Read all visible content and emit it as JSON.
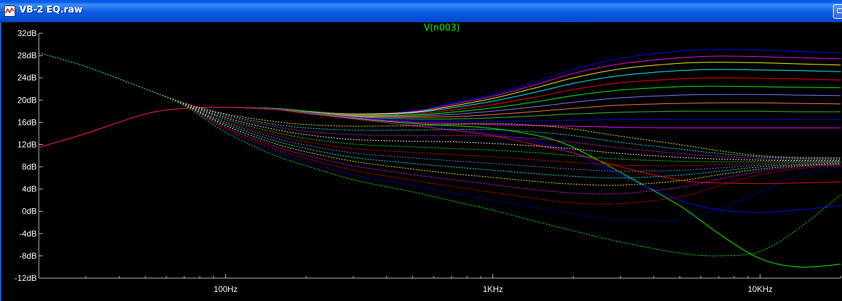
{
  "window": {
    "title": "VB-2 EQ.raw"
  },
  "colors": {
    "background": "#000000",
    "axis": "#c0c0c0",
    "grid": "#808080",
    "trace_title": "#00ff00"
  },
  "chart_data": {
    "type": "line",
    "title": "V(n003)",
    "x_scale": "log",
    "xlim": [
      20,
      20000
    ],
    "ylim": [
      -12,
      32
    ],
    "grid": false,
    "x_ticks": [
      {
        "value": 100,
        "label": "100Hz"
      },
      {
        "value": 1000,
        "label": "1KHz"
      },
      {
        "value": 10000,
        "label": "10KHz"
      }
    ],
    "y_ticks": [
      {
        "value": 32,
        "label": "32dB"
      },
      {
        "value": 28,
        "label": "28dB"
      },
      {
        "value": 24,
        "label": "24dB"
      },
      {
        "value": 20,
        "label": "20dB"
      },
      {
        "value": 16,
        "label": "16dB"
      },
      {
        "value": 12,
        "label": "12dB"
      },
      {
        "value": 8,
        "label": "8dB"
      },
      {
        "value": 4,
        "label": "4dB"
      },
      {
        "value": 0,
        "label": "0dB"
      },
      {
        "value": -4,
        "label": "-4dB"
      },
      {
        "value": -8,
        "label": "-8dB"
      },
      {
        "value": -12,
        "label": "-12dB"
      }
    ],
    "x": [
      20,
      30,
      50,
      70,
      100,
      150,
      200,
      300,
      500,
      700,
      1000,
      1500,
      2000,
      3000,
      5000,
      7000,
      10000,
      14000,
      20000
    ],
    "series": [
      {
        "color": "#0000ff",
        "style": "solid",
        "values": [
          11.5,
          14,
          17.5,
          18.5,
          18.7,
          18.5,
          18,
          17.5,
          18,
          19.5,
          21,
          23.5,
          25.5,
          27.5,
          28.8,
          29.1,
          29,
          28.7,
          28.5
        ]
      },
      {
        "color": "#ff00ff",
        "style": "solid",
        "values": [
          11.5,
          14,
          17.5,
          18.5,
          18.7,
          18.5,
          18,
          17.5,
          17.9,
          19.2,
          20.7,
          23,
          24.8,
          26.5,
          27.6,
          27.9,
          27.8,
          27.6,
          27.4
        ]
      },
      {
        "color": "#ffff00",
        "style": "solid",
        "values": [
          11.5,
          14,
          17.5,
          18.5,
          18.7,
          18.5,
          18,
          17.5,
          17.8,
          18.9,
          20.3,
          22.4,
          24,
          25.6,
          26.6,
          26.8,
          26.7,
          26.5,
          26.3
        ]
      },
      {
        "color": "#00ffff",
        "style": "solid",
        "values": [
          11.5,
          14,
          17.5,
          18.5,
          18.7,
          18.5,
          18,
          17.4,
          17.7,
          18.6,
          19.8,
          21.6,
          23,
          24.4,
          25.3,
          25.5,
          25.4,
          25.3,
          25.1
        ]
      },
      {
        "color": "#ff0000",
        "style": "solid",
        "values": [
          11.5,
          14,
          17.5,
          18.5,
          18.7,
          18.5,
          18,
          17.4,
          17.5,
          18.2,
          19.2,
          20.7,
          21.9,
          23.1,
          23.8,
          24,
          23.9,
          23.8,
          23.6
        ]
      },
      {
        "color": "#00ff00",
        "style": "solid",
        "values": [
          11.5,
          14,
          17.5,
          18.5,
          18.7,
          18.5,
          18,
          17.3,
          17.3,
          17.8,
          18.6,
          19.8,
          20.8,
          21.8,
          22.4,
          22.5,
          22.4,
          22.3,
          22.2
        ]
      },
      {
        "color": "#8080ff",
        "style": "solid",
        "values": [
          11.5,
          14,
          17.5,
          18.5,
          18.7,
          18.4,
          17.9,
          17.2,
          17.1,
          17.4,
          18,
          18.9,
          19.6,
          20.4,
          20.9,
          21,
          21,
          20.9,
          20.8
        ]
      },
      {
        "color": "#ff8040",
        "style": "solid",
        "values": [
          11.5,
          14,
          17.5,
          18.5,
          18.7,
          18.4,
          17.9,
          17.1,
          16.9,
          17,
          17.4,
          18,
          18.5,
          19.1,
          19.4,
          19.5,
          19.5,
          19.4,
          19.3
        ]
      },
      {
        "color": "#40c040",
        "style": "solid",
        "values": [
          11.5,
          14,
          17.5,
          18.5,
          18.7,
          18.4,
          17.8,
          17,
          16.6,
          16.6,
          16.8,
          17.2,
          17.5,
          17.8,
          18,
          18,
          18,
          17.9,
          17.9
        ]
      },
      {
        "color": "#0000ff",
        "style": "solid",
        "values": [
          11.5,
          14,
          17.5,
          18.5,
          18.7,
          18.4,
          17.8,
          16.9,
          16.3,
          16.2,
          16.2,
          16.3,
          16.4,
          16.5,
          16.5,
          16.5,
          16.5,
          16.5,
          16.5
        ]
      },
      {
        "color": "#ff00ff",
        "style": "solid",
        "values": [
          11.5,
          14,
          17.5,
          18.5,
          18.7,
          18.3,
          17.7,
          16.8,
          16,
          15.8,
          15.6,
          15.4,
          15.3,
          15.1,
          15,
          15,
          15,
          15,
          15
        ]
      },
      {
        "color": "#00ff00",
        "style": "solid",
        "values": [
          11.5,
          14,
          17.5,
          18.5,
          18.7,
          18.3,
          17.7,
          16.7,
          15.8,
          15.4,
          14.9,
          13.5,
          11.5,
          7,
          1,
          -4,
          -8.5,
          -10,
          -9.5
        ]
      },
      {
        "color": "#0000ff",
        "style": "solid",
        "values": [
          11.5,
          14,
          17.5,
          18.5,
          18.7,
          18.3,
          17.6,
          16.6,
          15.5,
          14.8,
          13.9,
          12.3,
          10.5,
          6.5,
          2,
          0.3,
          -0.2,
          0.3,
          1
        ]
      },
      {
        "color": "#ff0000",
        "style": "solid",
        "values": [
          11.5,
          14,
          17.5,
          18.5,
          18.7,
          18.3,
          17.6,
          16.6,
          15.4,
          14.6,
          13.6,
          11.8,
          10.5,
          8,
          5.6,
          5.1,
          5,
          5.1,
          5.3
        ]
      },
      {
        "color": "#ffff00",
        "style": "dashed",
        "values": [
          28.5,
          26,
          22,
          19.5,
          17.5,
          16.2,
          15.6,
          15.3,
          15.4,
          15.6,
          15.8,
          15.4,
          14.8,
          13.5,
          12,
          10.9,
          10,
          9.7,
          9.6
        ]
      },
      {
        "color": "#00ffff",
        "style": "dashed",
        "values": [
          28.5,
          26,
          22,
          19.5,
          17.3,
          15.7,
          15,
          14.6,
          14.6,
          14.7,
          14.7,
          14.2,
          13.6,
          12.4,
          11.2,
          10.4,
          9.8,
          9.5,
          9.4
        ]
      },
      {
        "color": "#ff00ff",
        "style": "dashed",
        "values": [
          28.5,
          26,
          22,
          19.5,
          17.1,
          15.3,
          14.4,
          13.8,
          13.6,
          13.6,
          13.5,
          13,
          12.4,
          11.4,
          10.4,
          9.9,
          9.5,
          9.3,
          9.3
        ]
      },
      {
        "color": "#ffffff",
        "style": "dashed",
        "values": [
          28.5,
          26,
          22,
          19.4,
          16.8,
          14.8,
          13.8,
          12.9,
          12.6,
          12.5,
          12.2,
          11.7,
          11.2,
          10.4,
          9.7,
          9.4,
          9.2,
          9.1,
          9.1
        ]
      },
      {
        "color": "#00ff00",
        "style": "dashed",
        "values": [
          28.5,
          26,
          22,
          19.4,
          16.5,
          14.3,
          13.1,
          12.1,
          11.6,
          11.3,
          11,
          10.5,
          10,
          9.4,
          9,
          8.9,
          8.9,
          8.9,
          9
        ]
      },
      {
        "color": "#ff0000",
        "style": "dashed",
        "values": [
          28.5,
          26,
          22,
          19.3,
          16.2,
          13.8,
          12.5,
          11.3,
          10.6,
          10.2,
          9.8,
          9.2,
          8.8,
          8.3,
          8.2,
          8.4,
          8.6,
          8.8,
          8.9
        ]
      },
      {
        "color": "#8080ff",
        "style": "dashed",
        "values": [
          28.5,
          26,
          22,
          19.3,
          16,
          13.3,
          11.9,
          10.5,
          9.6,
          9.1,
          8.6,
          8,
          7.6,
          7.2,
          7.4,
          7.8,
          8.3,
          8.6,
          8.8
        ]
      },
      {
        "color": "#00ffff",
        "style": "dashed",
        "values": [
          28.5,
          26,
          22,
          19.2,
          15.7,
          12.8,
          11.3,
          9.7,
          8.6,
          8,
          7.4,
          6.7,
          6.3,
          6,
          6.5,
          7.2,
          8,
          8.4,
          8.7
        ]
      },
      {
        "color": "#ffff00",
        "style": "dashed",
        "values": [
          28.5,
          26,
          22,
          19.2,
          15.4,
          12.3,
          10.7,
          9,
          7.6,
          6.8,
          6.1,
          5.3,
          4.9,
          4.7,
          5.5,
          6.6,
          7.6,
          8.2,
          8.5
        ]
      },
      {
        "color": "#ff00ff",
        "style": "dashed",
        "values": [
          28.5,
          26,
          22,
          19.1,
          15.1,
          11.8,
          10.1,
          8.2,
          6.6,
          5.7,
          4.8,
          3.8,
          3.3,
          3.2,
          4.3,
          5.8,
          7.2,
          8,
          8.4
        ]
      },
      {
        "color": "#ff0000",
        "style": "dashed",
        "values": [
          28.5,
          26,
          22,
          19.1,
          14.8,
          11.3,
          9.5,
          7.4,
          5.6,
          4.5,
          3.4,
          2.2,
          1.5,
          1.4,
          2.6,
          4.6,
          6.6,
          7.7,
          8.2
        ]
      },
      {
        "color": "#0000ff",
        "style": "dashed",
        "values": [
          28.5,
          26,
          22,
          19,
          14.5,
          10.8,
          8.9,
          6.6,
          4.6,
          3.3,
          2,
          0.5,
          -0.5,
          -1.6,
          -1.5,
          0.5,
          3.5,
          6.5,
          8
        ]
      },
      {
        "color": "#00ff00",
        "style": "dashed",
        "values": [
          28.5,
          26,
          22,
          19,
          14.2,
          10.2,
          8.2,
          5.7,
          3.5,
          1.9,
          0.2,
          -2,
          -3.5,
          -5.5,
          -7.5,
          -8,
          -7.2,
          -3,
          3
        ]
      }
    ]
  }
}
